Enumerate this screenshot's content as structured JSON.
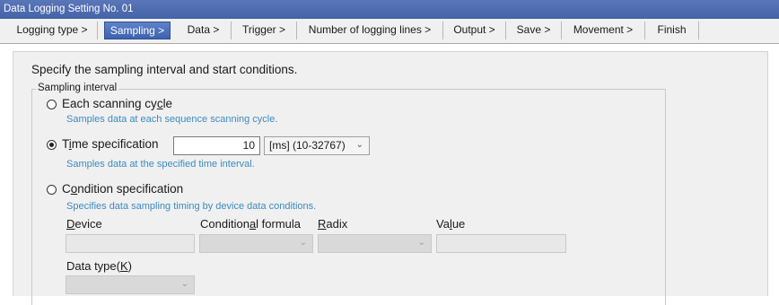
{
  "window": {
    "title": "Data Logging Setting No. 01"
  },
  "tabs": [
    {
      "label": "Logging type >",
      "active": false
    },
    {
      "label": "Sampling >",
      "active": true
    },
    {
      "label": "Data >",
      "active": false
    },
    {
      "label": "Trigger >",
      "active": false
    },
    {
      "label": "Number of logging lines >",
      "active": false
    },
    {
      "label": "Output >",
      "active": false
    },
    {
      "label": "Save >",
      "active": false
    },
    {
      "label": "Movement >",
      "active": false
    },
    {
      "label": "Finish",
      "active": false
    }
  ],
  "main": {
    "instruction": "Specify the sampling interval and start conditions.",
    "group_label": "Sampling interval",
    "options": {
      "each_scan": {
        "label_pre": "Each scanning cy",
        "label_mnemonic": "c",
        "label_post": "le",
        "description": "Samples data at each sequence scanning cycle.",
        "selected": false
      },
      "time_spec": {
        "label_pre": "T",
        "label_mnemonic": "i",
        "label_post": "me specification",
        "description": "Samples data at the specified time interval.",
        "selected": true,
        "value": "10",
        "unit_selected": "[ms] (10-32767)"
      },
      "condition_spec": {
        "label_pre": "C",
        "label_mnemonic": "o",
        "label_post": "ndition specification",
        "description": "Specifies data sampling timing by device data conditions.",
        "selected": false
      }
    },
    "fields": {
      "device": {
        "pre": "",
        "mnemonic": "D",
        "post": "evice"
      },
      "conditional_formula": {
        "pre": "Condition",
        "mnemonic": "a",
        "post": "l formula"
      },
      "radix": {
        "pre": "",
        "mnemonic": "R",
        "post": "adix"
      },
      "value": {
        "pre": "Va",
        "mnemonic": "l",
        "post": "ue"
      },
      "data_type": {
        "pre": "Data type(",
        "mnemonic": "K",
        "post": ")"
      }
    }
  }
}
